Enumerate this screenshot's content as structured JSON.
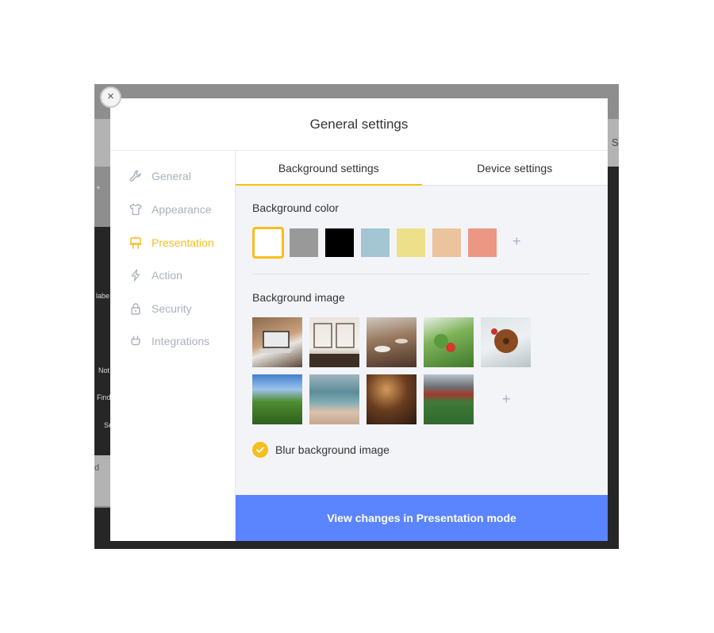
{
  "close_button": {
    "symbol": "×"
  },
  "modal": {
    "title": "General settings"
  },
  "backdrop_fragments": [
    "+",
    "labe",
    "Not",
    "Find",
    "Se",
    "d",
    "S"
  ],
  "sidebar": {
    "items": [
      {
        "label": "General",
        "icon": "wrench-icon",
        "active": false
      },
      {
        "label": "Appearance",
        "icon": "tshirt-icon",
        "active": false
      },
      {
        "label": "Presentation",
        "icon": "easel-icon",
        "active": true
      },
      {
        "label": "Action",
        "icon": "bolt-icon",
        "active": false
      },
      {
        "label": "Security",
        "icon": "lock-icon",
        "active": false
      },
      {
        "label": "Integrations",
        "icon": "plug-icon",
        "active": false
      }
    ]
  },
  "tabs": [
    {
      "label": "Background settings",
      "active": true
    },
    {
      "label": "Device settings",
      "active": false
    }
  ],
  "background_color": {
    "label": "Background color",
    "swatches": [
      "#ffffff",
      "#999999",
      "#000000",
      "#a3c6d2",
      "#ece08a",
      "#ebc39c",
      "#ec9784"
    ],
    "selected_index": 0,
    "add_symbol": "+"
  },
  "background_image": {
    "label": "Background image",
    "images": [
      "laptop-on-desk-image",
      "workspace-window-image",
      "cafe-table-image",
      "salad-image",
      "bagel-image",
      "green-valley-image",
      "beach-image",
      "restaurant-interior-image",
      "stadium-image"
    ],
    "add_symbol": "+"
  },
  "blur": {
    "label": "Blur background image",
    "checked": true
  },
  "cta": {
    "label": "View changes in Presentation mode"
  },
  "colors": {
    "accent": "#f7be1c",
    "primary_button": "#5b84ff",
    "muted_text": "#aab1bd"
  }
}
